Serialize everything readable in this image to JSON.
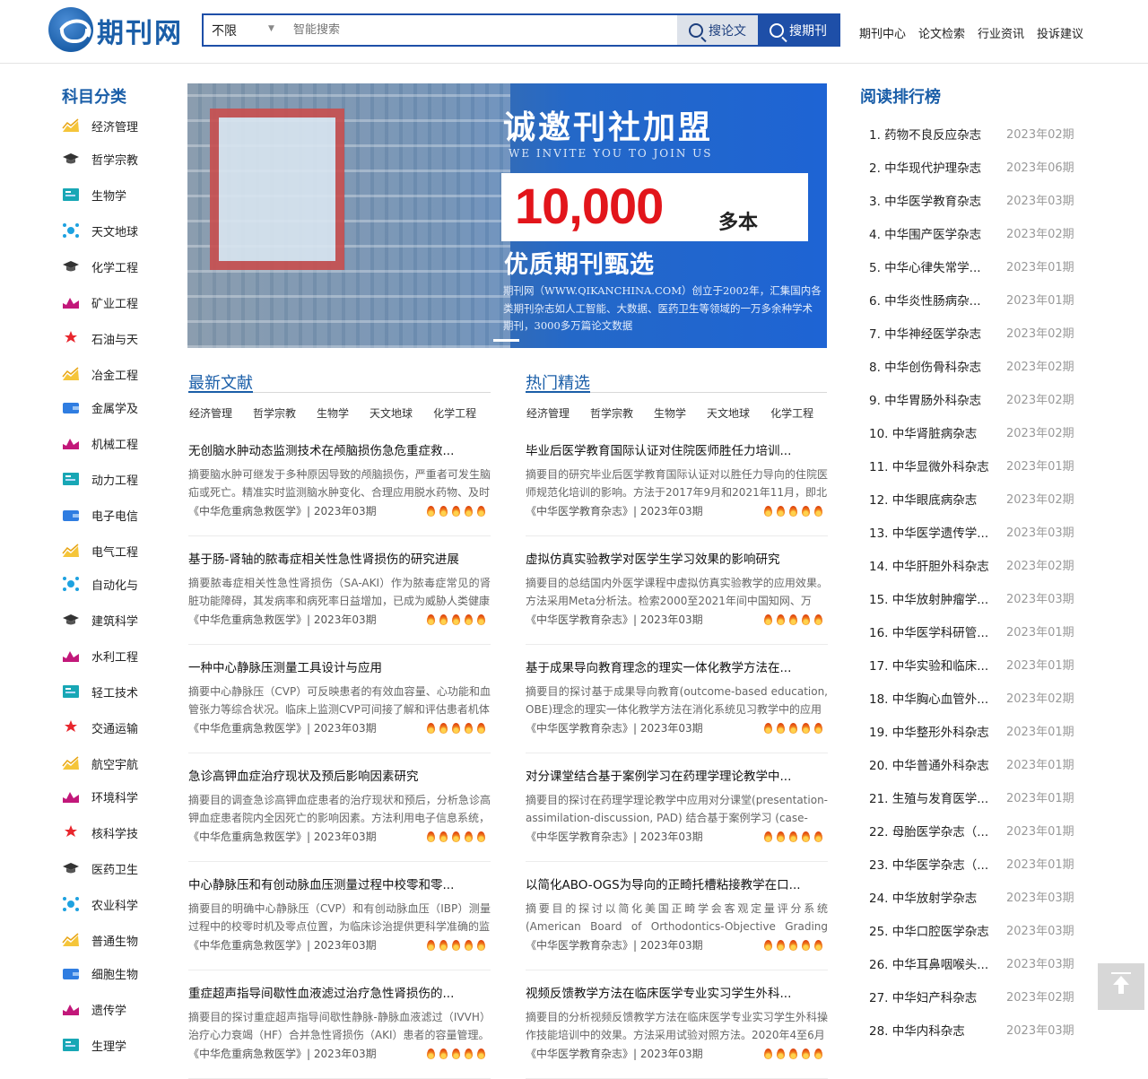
{
  "header": {
    "logo_text": "期刊网",
    "search": {
      "scope": "不限",
      "placeholder": "智能搜索",
      "search_articles_label": "搜论文",
      "search_journals_label": "搜期刊"
    },
    "nav": [
      "期刊中心",
      "论文检索",
      "行业资讯",
      "投诉建议"
    ]
  },
  "categories": {
    "title": "科目分类",
    "items": [
      {
        "label": "经济管理",
        "icon": "chart-icon"
      },
      {
        "label": "哲学宗教",
        "icon": "graduation-cap-icon"
      },
      {
        "label": "生物学",
        "icon": "board-icon"
      },
      {
        "label": "天文地球",
        "icon": "network-icon"
      },
      {
        "label": "化学工程",
        "icon": "graduation-cap-icon"
      },
      {
        "label": "矿业工程",
        "icon": "bar-chart-icon"
      },
      {
        "label": "石油与天",
        "icon": "pin-icon"
      },
      {
        "label": "冶金工程",
        "icon": "chart-icon"
      },
      {
        "label": "金属学及",
        "icon": "wallet-icon"
      },
      {
        "label": "机械工程",
        "icon": "bar-chart-icon"
      },
      {
        "label": "动力工程",
        "icon": "board-icon"
      },
      {
        "label": "电子电信",
        "icon": "wallet-icon"
      },
      {
        "label": "电气工程",
        "icon": "chart-icon"
      },
      {
        "label": "自动化与",
        "icon": "network-icon"
      },
      {
        "label": "建筑科学",
        "icon": "graduation-cap-icon"
      },
      {
        "label": "水利工程",
        "icon": "bar-chart-icon"
      },
      {
        "label": "轻工技术",
        "icon": "board-icon"
      },
      {
        "label": "交通运输",
        "icon": "pin-icon"
      },
      {
        "label": "航空宇航",
        "icon": "chart-icon"
      },
      {
        "label": "环境科学",
        "icon": "bar-chart-icon"
      },
      {
        "label": "核科学技",
        "icon": "pin-icon"
      },
      {
        "label": "医药卫生",
        "icon": "graduation-cap-icon"
      },
      {
        "label": "农业科学",
        "icon": "network-icon"
      },
      {
        "label": "普通生物",
        "icon": "chart-icon"
      },
      {
        "label": "细胞生物",
        "icon": "wallet-icon"
      },
      {
        "label": "遗传学",
        "icon": "bar-chart-icon"
      },
      {
        "label": "生理学",
        "icon": "board-icon"
      }
    ]
  },
  "banner": {
    "title": "诚邀刊社加盟",
    "subtitle": "WE INVITE YOU TO JOIN US",
    "number": "10,000",
    "unit": "多本",
    "tagline": "优质期刊甄选",
    "desc": "期刊网（WWW.QIKANCHINA.COM）创立于2002年，汇集国内各类期刊杂志如人工智能、大数据、医药卫生等领域的一万多余种学术期刊，3000多万篇论文数据"
  },
  "latest": {
    "title": "最新文献",
    "tabs": [
      "经济管理",
      "哲学宗教",
      "生物学",
      "天文地球",
      "化学工程"
    ],
    "articles": [
      {
        "title": "无创脑水肿动态监测技术在颅脑损伤急危重症救...",
        "abstract": "摘要脑水肿可继发于多种原因导致的颅脑损伤，严重者可发生脑疝或死亡。精准实时监测脑水肿变化、合理应用脱水药物、及时",
        "source": "《中华危重病急救医学》| 2023年03期"
      },
      {
        "title": "基于肠-肾轴的脓毒症相关性急性肾损伤的研究进展",
        "abstract": "摘要脓毒症相关性急性肾损伤（SA-AKI）作为脓毒症常见的肾脏功能障碍，其发病率和病死率日益增加，已成为威胁人类健康",
        "source": "《中华危重病急救医学》| 2023年03期"
      },
      {
        "title": "一种中心静脉压测量工具设计与应用",
        "abstract": "摘要中心静脉压（CVP）可反映患者的有效血容量、心功能和血管张力等综合状况。临床上监测CVP可间接了解和评估患者机体",
        "source": "《中华危重病急救医学》| 2023年03期"
      },
      {
        "title": "急诊高钾血症治疗现状及预后影响因素研究",
        "abstract": "摘要目的调查急诊高钾血症患者的治疗现状和预后，分析急诊高钾血症患者院内全因死亡的影响因素。方法利用电子信息系统，",
        "source": "《中华危重病急救医学》| 2023年03期"
      },
      {
        "title": "中心静脉压和有创动脉血压测量过程中校零和零...",
        "abstract": "摘要目的明确中心静脉压（CVP）和有创动脉血压（IBP）测量过程中的校零时机及零点位置，为临床诊治提供更科学准确的监",
        "source": "《中华危重病急救医学》| 2023年03期"
      },
      {
        "title": "重症超声指导间歇性血液滤过治疗急性肾损伤的...",
        "abstract": "摘要目的探讨重症超声指导间歇性静脉-静脉血液滤过（IVVH）治疗心力衰竭（HF）合并急性肾损伤（AKI）患者的容量管理。",
        "source": "《中华危重病急救医学》| 2023年03期"
      }
    ]
  },
  "hot": {
    "title": "热门精选",
    "tabs": [
      "经济管理",
      "哲学宗教",
      "生物学",
      "天文地球",
      "化学工程"
    ],
    "articles": [
      {
        "title": "毕业后医学教育国际认证对住院医师胜任力培训...",
        "abstract": "摘要目的研究毕业后医学教育国际认证对以胜任力导向的住院医师规范化培训的影响。方法于2017年9月和2021年11月，即北",
        "source": "《中华医学教育杂志》| 2023年03期"
      },
      {
        "title": "虚拟仿真实验教学对医学生学习效果的影响研究",
        "abstract": "摘要目的总结国内外医学课程中虚拟仿真实验教学的应用效果。方法采用Meta分析法。检索2000至2021年间中国知网、万",
        "source": "《中华医学教育杂志》| 2023年03期"
      },
      {
        "title": "基于成果导向教育理念的理实一体化教学方法在...",
        "abstract": "摘要目的探讨基于成果导向教育(outcome-based education, OBE)理念的理实一体化教学方法在消化系统见习教学中的应用",
        "source": "《中华医学教育杂志》| 2023年03期"
      },
      {
        "title": "对分课堂结合基于案例学习在药理学理论教学中...",
        "abstract": "摘要目的探讨在药理学理论教学中应用对分课堂(presentation-assimilation-discussion, PAD) 结合基于案例学习 (case-",
        "source": "《中华医学教育杂志》| 2023年03期"
      },
      {
        "title": "以简化ABO-OGS为导向的正畸托槽粘接教学在口...",
        "abstract": "摘要目的探讨以简化美国正畸学会客观定量评分系统(American Board of Orthodontics-Objective Grading System, ABO-",
        "source": "《中华医学教育杂志》| 2023年03期"
      },
      {
        "title": "视频反馈教学方法在临床医学专业实习学生外科...",
        "abstract": "摘要目的分析视频反馈教学方法在临床医学专业实习学生外科操作技能培训中的效果。方法采用试验对照方法。2020年4至6月",
        "source": "《中华医学教育杂志》| 2023年03期"
      }
    ]
  },
  "ranking": {
    "title": "阅读排行榜",
    "items": [
      {
        "name": "1. 药物不良反应杂志",
        "issue": "2023年02期"
      },
      {
        "name": "2. 中华现代护理杂志",
        "issue": "2023年06期"
      },
      {
        "name": "3. 中华医学教育杂志",
        "issue": "2023年03期"
      },
      {
        "name": "4. 中华围产医学杂志",
        "issue": "2023年02期"
      },
      {
        "name": "5. 中华心律失常学...",
        "issue": "2023年01期"
      },
      {
        "name": "6. 中华炎性肠病杂...",
        "issue": "2023年01期"
      },
      {
        "name": "7. 中华神经医学杂志",
        "issue": "2023年02期"
      },
      {
        "name": "8. 中华创伤骨科杂志",
        "issue": "2023年02期"
      },
      {
        "name": "9. 中华胃肠外科杂志",
        "issue": "2023年02期"
      },
      {
        "name": "10. 中华肾脏病杂志",
        "issue": "2023年02期"
      },
      {
        "name": "11. 中华显微外科杂志",
        "issue": "2023年01期"
      },
      {
        "name": "12. 中华眼底病杂志",
        "issue": "2023年02期"
      },
      {
        "name": "13. 中华医学遗传学...",
        "issue": "2023年03期"
      },
      {
        "name": "14. 中华肝胆外科杂志",
        "issue": "2023年02期"
      },
      {
        "name": "15. 中华放射肿瘤学...",
        "issue": "2023年03期"
      },
      {
        "name": "16. 中华医学科研管...",
        "issue": "2023年01期"
      },
      {
        "name": "17. 中华实验和临床...",
        "issue": "2023年01期"
      },
      {
        "name": "18. 中华胸心血管外...",
        "issue": "2023年02期"
      },
      {
        "name": "19. 中华整形外科杂志",
        "issue": "2023年01期"
      },
      {
        "name": "20. 中华普通外科杂志",
        "issue": "2023年01期"
      },
      {
        "name": "21. 生殖与发育医学...",
        "issue": "2023年01期"
      },
      {
        "name": "22. 母胎医学杂志（...",
        "issue": "2023年01期"
      },
      {
        "name": "23. 中华医学杂志（...",
        "issue": "2023年01期"
      },
      {
        "name": "24. 中华放射学杂志",
        "issue": "2023年03期"
      },
      {
        "name": "25. 中华口腔医学杂志",
        "issue": "2023年03期"
      },
      {
        "name": "26. 中华耳鼻咽喉头...",
        "issue": "2023年03期"
      },
      {
        "name": "27. 中华妇产科杂志",
        "issue": "2023年02期"
      },
      {
        "name": "28. 中华内科杂志",
        "issue": "2023年03期"
      }
    ]
  },
  "colors": {
    "brand": "#1a5ea8",
    "search_button": "#1e4fa8",
    "number_red": "#e2151b",
    "flame": "#f07a1a"
  }
}
